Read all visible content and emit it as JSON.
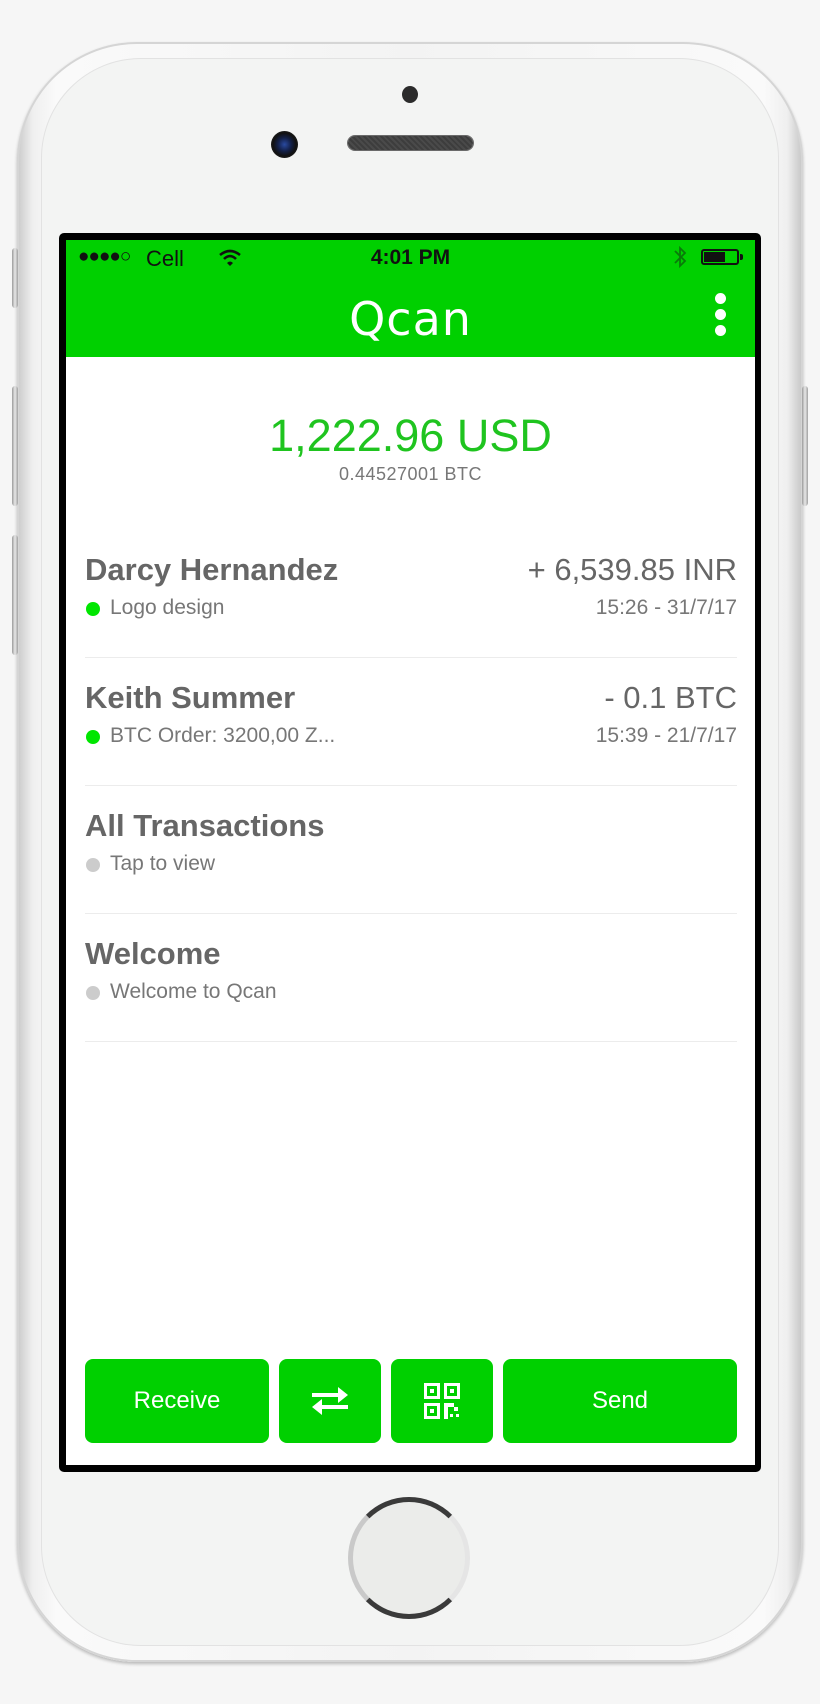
{
  "status_bar": {
    "signal": "●●●●○",
    "carrier": "Cell",
    "time": "4:01 PM",
    "bluetooth_icon": "bluetooth-icon",
    "wifi_icon": "wifi-icon",
    "battery_level_percent": 65
  },
  "header": {
    "title": "Qcan",
    "menu_icon": "more-vertical-icon"
  },
  "balance": {
    "fiat": "1,222.96 USD",
    "crypto": "0.44527001 BTC"
  },
  "colors": {
    "brand_green": "#00d000",
    "balance_green": "#1fc41f",
    "active_dot": "#00e600",
    "inactive_dot": "#cccccc",
    "text_gray": "#666666"
  },
  "items": [
    {
      "title": "Darcy Hernandez",
      "amount": "+ 6,539.85 INR",
      "subtitle": "Logo design",
      "time": "15:26 - 31/7/17",
      "status": "active"
    },
    {
      "title": "Keith Summer",
      "amount": "- 0.1 BTC",
      "subtitle": "BTC Order: 3200,00 Z...",
      "time": "15:39 - 21/7/17",
      "status": "active"
    },
    {
      "title": "All Transactions",
      "amount": "",
      "subtitle": "Tap to view",
      "time": "",
      "status": "inactive"
    },
    {
      "title": "Welcome",
      "amount": "",
      "subtitle": "Welcome to Qcan",
      "time": "",
      "status": "inactive"
    }
  ],
  "actions": {
    "receive": "Receive",
    "exchange_icon": "swap-arrows-icon",
    "qr_icon": "qr-code-icon",
    "send": "Send"
  }
}
